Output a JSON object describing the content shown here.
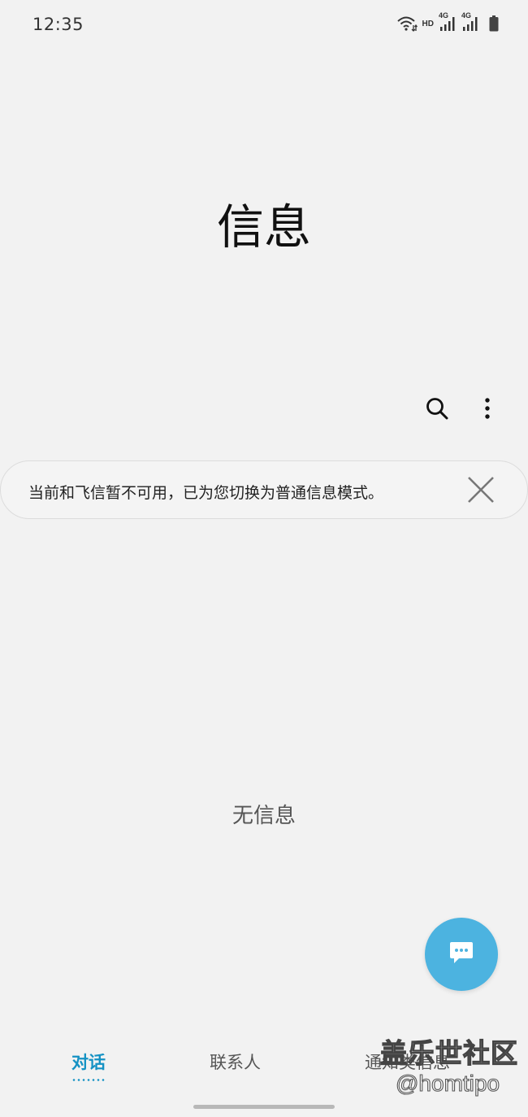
{
  "status_bar": {
    "time": "12:35",
    "hd": "HD",
    "network1": "4G",
    "network2": "4G",
    "icons": [
      "wifi-icon",
      "signal-icon",
      "signal-icon",
      "battery-icon"
    ]
  },
  "header": {
    "title": "信息"
  },
  "toolbar": {
    "search_icon": "search-icon",
    "more_icon": "more-options-icon"
  },
  "notice": {
    "text": "当前和飞信暂不可用，已为您切换为普通信息模式。",
    "close_icon": "close-icon"
  },
  "empty_state": {
    "text": "无信息"
  },
  "fab": {
    "icon": "compose-message-icon",
    "color": "#4cb3e0"
  },
  "bottom_nav": {
    "tabs": [
      {
        "label": "对话",
        "active": true
      },
      {
        "label": "联系人",
        "active": false
      },
      {
        "label": "通知类信息",
        "active": false
      }
    ],
    "accent": "#1592c4"
  },
  "watermark": {
    "site": "盖乐世社区",
    "handle": "@homtipo"
  }
}
